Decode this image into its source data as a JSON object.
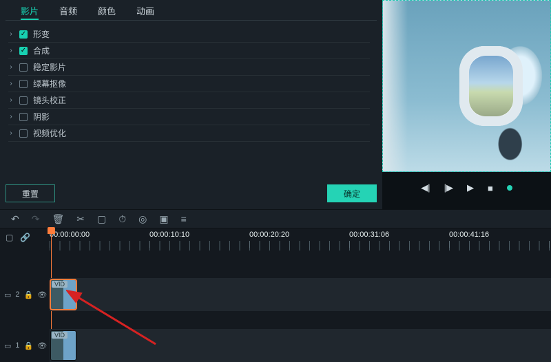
{
  "tabs": {
    "clip": "影片",
    "audio": "音频",
    "color": "颜色",
    "motion": "动画"
  },
  "options": {
    "transform": {
      "label": "形变",
      "checked": true
    },
    "compositing": {
      "label": "合成",
      "checked": true
    },
    "stabilize": {
      "label": "稳定影片",
      "checked": false
    },
    "greenscreen": {
      "label": "绿幕抠像",
      "checked": false
    },
    "lenscorr": {
      "label": "镜头校正",
      "checked": false
    },
    "shadow": {
      "label": "阴影",
      "checked": false
    },
    "optimize": {
      "label": "视频优化",
      "checked": false
    }
  },
  "buttons": {
    "reset": "重置",
    "ok": "确定"
  },
  "timeline": {
    "timecodes": [
      "00:00:00:00",
      "00:00:10:10",
      "00:00:20:20",
      "00:00:31:06",
      "00:00:41:16"
    ],
    "track2_label": "2",
    "track1_label": "1",
    "clip_tag": "VID"
  }
}
